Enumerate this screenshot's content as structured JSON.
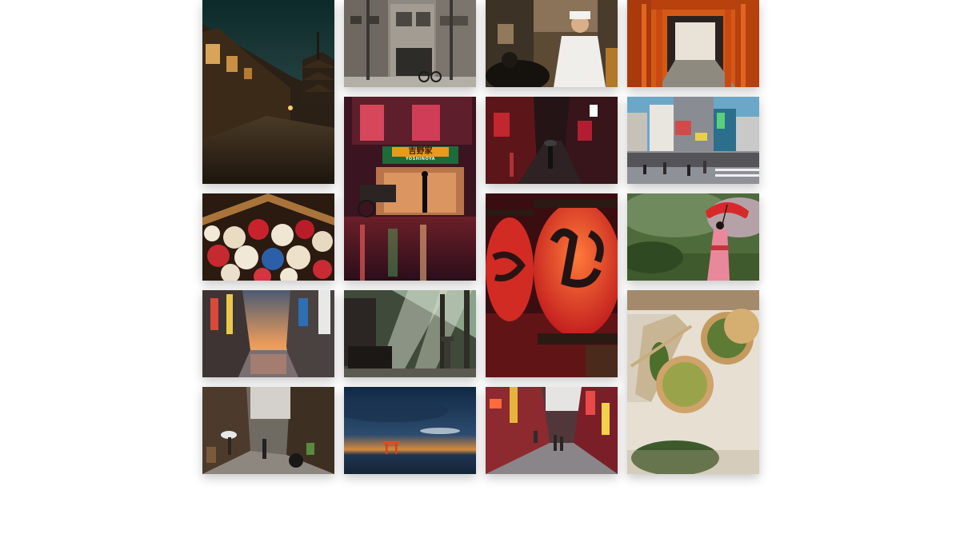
{
  "gallery": {
    "tiles": [
      {
        "name": "kyoto-pagoda-street"
      },
      {
        "name": "tokyo-street-corner"
      },
      {
        "name": "ramen-chef-kitchen"
      },
      {
        "name": "torii-gate-tunnel"
      },
      {
        "name": "yoshinoya-night-reflection",
        "sign_text": "吉野家",
        "sub_text": "YOSHINOYA"
      },
      {
        "name": "rainy-red-alley"
      },
      {
        "name": "shibuya-crossing"
      },
      {
        "name": "paper-umbrella-display"
      },
      {
        "name": "red-paper-lanterns"
      },
      {
        "name": "kimono-woman-red-parasol"
      },
      {
        "name": "dotonbori-canal-sunset"
      },
      {
        "name": "temple-sunbeams-forest"
      },
      {
        "name": "matcha-green-tea"
      },
      {
        "name": "rainy-street-pedestrians"
      },
      {
        "name": "floating-torii-twilight"
      },
      {
        "name": "neon-shopping-street"
      }
    ]
  }
}
